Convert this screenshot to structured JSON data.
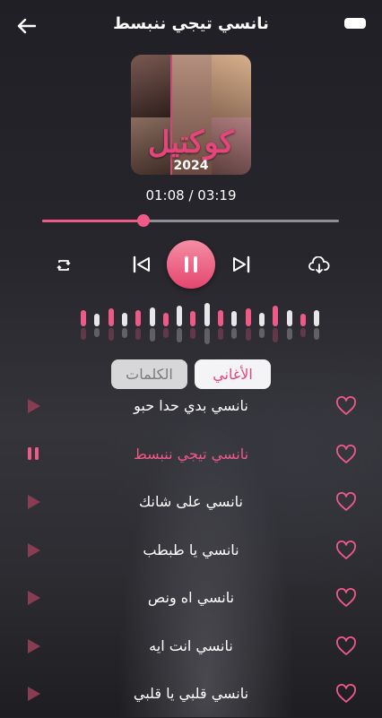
{
  "header": {
    "title": "نانسي تيجي ننبسط"
  },
  "album": {
    "cover_text": "كوكتيل",
    "cover_year": "2024"
  },
  "player": {
    "time_text": "01:08 / 03:19",
    "progress": 0.34,
    "accent": "#ef5a89"
  },
  "equalizer": {
    "levels": [
      0.6,
      0.45,
      0.65,
      0.5,
      0.6,
      0.7,
      0.5,
      0.75,
      0.55,
      0.85,
      0.6,
      0.55,
      0.65,
      0.5,
      0.75,
      0.6,
      0.45,
      0.6
    ],
    "colors": [
      "#ee5a86",
      "#e8e6e8"
    ]
  },
  "tabs": {
    "songs_label": "الأغاني",
    "lyrics_label": "الكلمات"
  },
  "songs": [
    {
      "title": "نانسي بدي حدا حبو",
      "playing": false
    },
    {
      "title": "نانسي تيجي ننبسط",
      "playing": true
    },
    {
      "title": "نانسي على شانك",
      "playing": false
    },
    {
      "title": "نانسي يا طبطب",
      "playing": false
    },
    {
      "title": "نانسي اه ونص",
      "playing": false
    },
    {
      "title": "نانسي انت ايه",
      "playing": false
    },
    {
      "title": "نانسي قلبي يا قلبي",
      "playing": false
    }
  ]
}
